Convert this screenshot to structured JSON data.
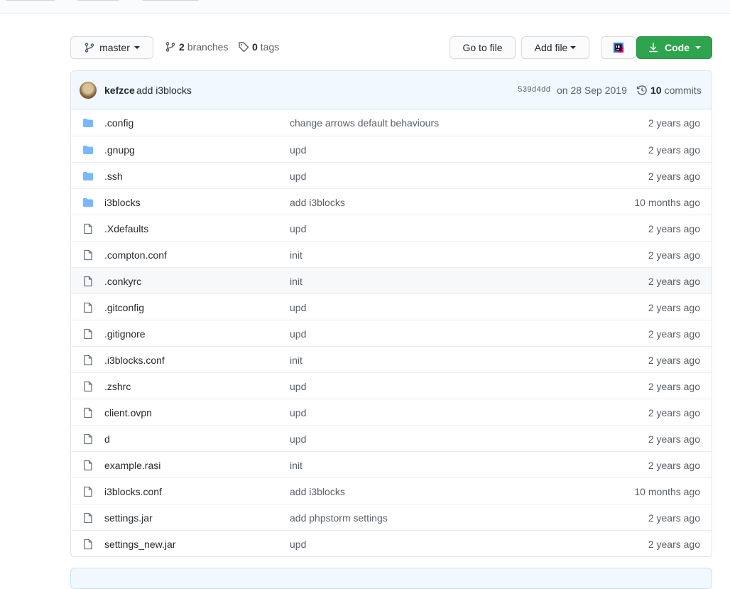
{
  "toolbar": {
    "branch_label": "master",
    "branches_count": "2",
    "branches_label": "branches",
    "tags_count": "0",
    "tags_label": "tags",
    "go_to_file": "Go to file",
    "add_file": "Add file",
    "code": "Code"
  },
  "latest_commit": {
    "author": "kefzce",
    "message": "add i3blocks",
    "sha": "539d4dd",
    "date": "on 28 Sep 2019",
    "commits_count": "10",
    "commits_label": "commits"
  },
  "files": [
    {
      "type": "folder",
      "name": ".config",
      "message": "change arrows default behaviours",
      "age": "2 years ago"
    },
    {
      "type": "folder",
      "name": ".gnupg",
      "message": "upd",
      "age": "2 years ago"
    },
    {
      "type": "folder",
      "name": ".ssh",
      "message": "upd",
      "age": "2 years ago"
    },
    {
      "type": "folder",
      "name": "i3blocks",
      "message": "add i3blocks",
      "age": "10 months ago"
    },
    {
      "type": "file",
      "name": ".Xdefaults",
      "message": "upd",
      "age": "2 years ago"
    },
    {
      "type": "file",
      "name": ".compton.conf",
      "message": "init",
      "age": "2 years ago"
    },
    {
      "type": "file",
      "name": ".conkyrc",
      "message": "init",
      "age": "2 years ago"
    },
    {
      "type": "file",
      "name": ".gitconfig",
      "message": "upd",
      "age": "2 years ago"
    },
    {
      "type": "file",
      "name": ".gitignore",
      "message": "upd",
      "age": "2 years ago"
    },
    {
      "type": "file",
      "name": ".i3blocks.conf",
      "message": "init",
      "age": "2 years ago"
    },
    {
      "type": "file",
      "name": ".zshrc",
      "message": "upd",
      "age": "2 years ago"
    },
    {
      "type": "file",
      "name": "client.ovpn",
      "message": "upd",
      "age": "2 years ago"
    },
    {
      "type": "file",
      "name": "d",
      "message": "upd",
      "age": "2 years ago"
    },
    {
      "type": "file",
      "name": "example.rasi",
      "message": "init",
      "age": "2 years ago"
    },
    {
      "type": "file",
      "name": "i3blocks.conf",
      "message": "add i3blocks",
      "age": "10 months ago"
    },
    {
      "type": "file",
      "name": "settings.jar",
      "message": "add phpstorm settings",
      "age": "2 years ago"
    },
    {
      "type": "file",
      "name": "settings_new.jar",
      "message": "upd",
      "age": "2 years ago"
    }
  ],
  "colors": {
    "folder_icon": "#79b8ff",
    "file_icon": "#6a737d",
    "code_button": "#2ea44f",
    "header_bg": "#f1f8ff"
  }
}
